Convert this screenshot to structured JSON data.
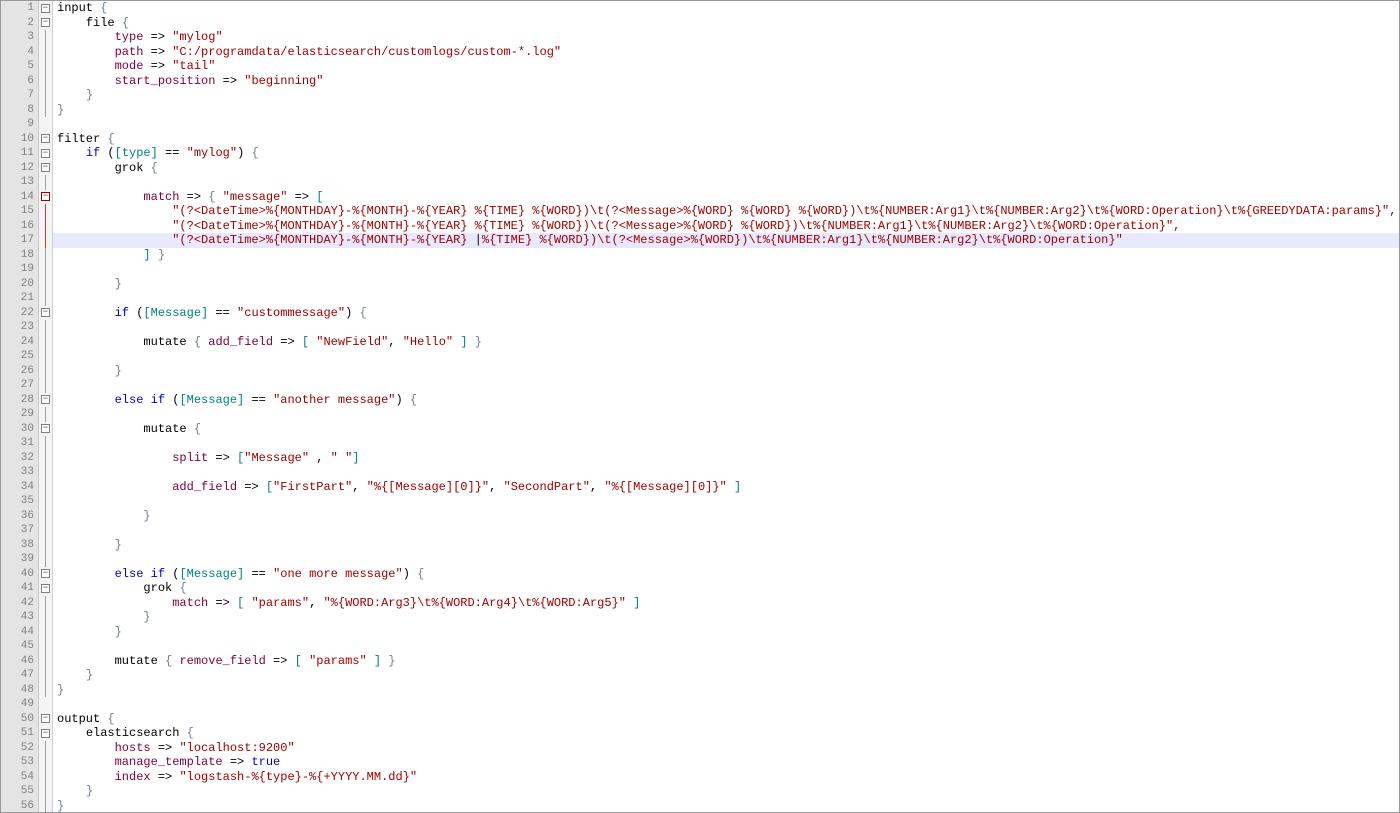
{
  "highlighted_line": 17,
  "lines": [
    {
      "n": 1,
      "fold": "minus",
      "segs": [
        {
          "t": "input",
          "c": "tok-kw"
        },
        {
          "t": " "
        },
        {
          "t": "{",
          "c": "tok-brace"
        }
      ]
    },
    {
      "n": 2,
      "fold": "minus",
      "indent": 4,
      "segs": [
        {
          "t": "file",
          "c": "tok-kw"
        },
        {
          "t": " "
        },
        {
          "t": "{",
          "c": "tok-brace"
        }
      ]
    },
    {
      "n": 3,
      "fold": "v",
      "indent": 8,
      "segs": [
        {
          "t": "type",
          "c": "tok-attr"
        },
        {
          "t": " => "
        },
        {
          "t": "\"mylog\"",
          "c": "tok-s3"
        }
      ]
    },
    {
      "n": 4,
      "fold": "v",
      "indent": 8,
      "segs": [
        {
          "t": "path",
          "c": "tok-attr"
        },
        {
          "t": " => "
        },
        {
          "t": "\"C:/programdata/elasticsearch/customlogs/custom-*.log\"",
          "c": "tok-s3"
        }
      ]
    },
    {
      "n": 5,
      "fold": "v",
      "indent": 8,
      "segs": [
        {
          "t": "mode",
          "c": "tok-attr"
        },
        {
          "t": " => "
        },
        {
          "t": "\"tail\"",
          "c": "tok-s3"
        }
      ]
    },
    {
      "n": 6,
      "fold": "v",
      "indent": 8,
      "segs": [
        {
          "t": "start_position",
          "c": "tok-attr"
        },
        {
          "t": " => "
        },
        {
          "t": "\"beginning\"",
          "c": "tok-s3"
        }
      ]
    },
    {
      "n": 7,
      "fold": "v",
      "indent": 4,
      "segs": [
        {
          "t": "}",
          "c": "tok-brace"
        }
      ]
    },
    {
      "n": 8,
      "fold": "end",
      "segs": [
        {
          "t": "}",
          "c": "tok-brace"
        }
      ]
    },
    {
      "n": 9,
      "fold": "",
      "segs": []
    },
    {
      "n": 10,
      "fold": "minus",
      "segs": [
        {
          "t": "filter",
          "c": "tok-kw"
        },
        {
          "t": " "
        },
        {
          "t": "{",
          "c": "tok-brace"
        }
      ]
    },
    {
      "n": 11,
      "fold": "minus",
      "indent": 4,
      "segs": [
        {
          "t": "if",
          "c": "tok-id"
        },
        {
          "t": " ("
        },
        {
          "t": "[type]",
          "c": "tok-brkt"
        },
        {
          "t": " == "
        },
        {
          "t": "\"mylog\"",
          "c": "tok-s3"
        },
        {
          "t": ") "
        },
        {
          "t": "{",
          "c": "tok-brace"
        }
      ]
    },
    {
      "n": 12,
      "fold": "minus",
      "indent": 8,
      "segs": [
        {
          "t": "grok",
          "c": "tok-kw"
        },
        {
          "t": " "
        },
        {
          "t": "{",
          "c": "tok-brace"
        }
      ]
    },
    {
      "n": 13,
      "fold": "v",
      "segs": []
    },
    {
      "n": 14,
      "fold": "collapse",
      "indent": 12,
      "segs": [
        {
          "t": "match",
          "c": "tok-attr"
        },
        {
          "t": " => "
        },
        {
          "t": "{",
          "c": "tok-brace"
        },
        {
          "t": " "
        },
        {
          "t": "\"message\"",
          "c": "tok-s3"
        },
        {
          "t": " => "
        },
        {
          "t": "[",
          "c": "tok-brkt"
        }
      ]
    },
    {
      "n": 15,
      "fold": "vred",
      "indent": 16,
      "segs": [
        {
          "t": "\"(?<DateTime>%{MONTHDAY}-%{MONTH}-%{YEAR} %{TIME} %{WORD})\\t(?<Message>%{WORD} %{WORD} %{WORD})\\t%{NUMBER:Arg1}\\t%{NUMBER:Arg2}\\t%{WORD:Operation}\\t%{GREEDYDATA:params}\",",
          "c": "tok-s3"
        }
      ]
    },
    {
      "n": 16,
      "fold": "vred",
      "indent": 16,
      "segs": [
        {
          "t": "\"(?<DateTime>%{MONTHDAY}-%{MONTH}-%{YEAR} %{TIME} %{WORD})\\t(?<Message>%{WORD} %{WORD})\\t%{NUMBER:Arg1}\\t%{NUMBER:Arg2}\\t%{WORD:Operation}\",",
          "c": "tok-s3"
        }
      ]
    },
    {
      "n": 17,
      "fold": "vred",
      "indent": 16,
      "segs": [
        {
          "t": "\"(?<DateTime>%{MONTHDAY}-%{MONTH}-%{YEAR} ",
          "c": "tok-s3"
        },
        {
          "t": "|",
          "c": "tok-kw"
        },
        {
          "t": "%{TIME} %{WORD})\\t(?<Message>%{WORD})\\t%{NUMBER:Arg1}\\t%{NUMBER:Arg2}\\t%{WORD:Operation}\"",
          "c": "tok-s3"
        }
      ]
    },
    {
      "n": 18,
      "fold": "endv",
      "indent": 12,
      "segs": [
        {
          "t": "]",
          "c": "tok-brkt"
        },
        {
          "t": " "
        },
        {
          "t": "}",
          "c": "tok-brace"
        }
      ]
    },
    {
      "n": 19,
      "fold": "v",
      "segs": []
    },
    {
      "n": 20,
      "fold": "v",
      "indent": 8,
      "segs": [
        {
          "t": "}",
          "c": "tok-brace"
        }
      ]
    },
    {
      "n": 21,
      "fold": "v",
      "segs": []
    },
    {
      "n": 22,
      "fold": "minus",
      "indent": 8,
      "segs": [
        {
          "t": "if",
          "c": "tok-id"
        },
        {
          "t": " ("
        },
        {
          "t": "[Message]",
          "c": "tok-brkt"
        },
        {
          "t": " == "
        },
        {
          "t": "\"custommessage\"",
          "c": "tok-s3"
        },
        {
          "t": ") "
        },
        {
          "t": "{",
          "c": "tok-brace"
        }
      ]
    },
    {
      "n": 23,
      "fold": "v",
      "segs": []
    },
    {
      "n": 24,
      "fold": "v",
      "indent": 12,
      "segs": [
        {
          "t": "mutate",
          "c": "tok-kw"
        },
        {
          "t": " "
        },
        {
          "t": "{",
          "c": "tok-brace"
        },
        {
          "t": " "
        },
        {
          "t": "add_field",
          "c": "tok-attr"
        },
        {
          "t": " => "
        },
        {
          "t": "[",
          "c": "tok-brkt"
        },
        {
          "t": " "
        },
        {
          "t": "\"NewField\"",
          "c": "tok-s3"
        },
        {
          "t": ", "
        },
        {
          "t": "\"Hello\"",
          "c": "tok-s3"
        },
        {
          "t": " "
        },
        {
          "t": "]",
          "c": "tok-brkt"
        },
        {
          "t": " "
        },
        {
          "t": "}",
          "c": "tok-brace"
        }
      ]
    },
    {
      "n": 25,
      "fold": "v",
      "segs": []
    },
    {
      "n": 26,
      "fold": "v",
      "indent": 8,
      "segs": [
        {
          "t": "}",
          "c": "tok-brace"
        }
      ]
    },
    {
      "n": 27,
      "fold": "v",
      "segs": []
    },
    {
      "n": 28,
      "fold": "minus",
      "indent": 8,
      "segs": [
        {
          "t": "else",
          "c": "tok-id"
        },
        {
          "t": " "
        },
        {
          "t": "if",
          "c": "tok-id"
        },
        {
          "t": " ("
        },
        {
          "t": "[Message]",
          "c": "tok-brkt"
        },
        {
          "t": " == "
        },
        {
          "t": "\"another message\"",
          "c": "tok-s3"
        },
        {
          "t": ") "
        },
        {
          "t": "{",
          "c": "tok-brace"
        }
      ]
    },
    {
      "n": 29,
      "fold": "v",
      "segs": []
    },
    {
      "n": 30,
      "fold": "minus",
      "indent": 12,
      "segs": [
        {
          "t": "mutate",
          "c": "tok-kw"
        },
        {
          "t": " "
        },
        {
          "t": "{",
          "c": "tok-brace"
        }
      ]
    },
    {
      "n": 31,
      "fold": "v",
      "segs": []
    },
    {
      "n": 32,
      "fold": "v",
      "indent": 16,
      "segs": [
        {
          "t": "split",
          "c": "tok-attr"
        },
        {
          "t": " => "
        },
        {
          "t": "[",
          "c": "tok-brkt"
        },
        {
          "t": "\"Message\"",
          "c": "tok-s3"
        },
        {
          "t": " , "
        },
        {
          "t": "\" \"",
          "c": "tok-s3"
        },
        {
          "t": "]",
          "c": "tok-brkt"
        }
      ]
    },
    {
      "n": 33,
      "fold": "v",
      "segs": []
    },
    {
      "n": 34,
      "fold": "v",
      "indent": 16,
      "segs": [
        {
          "t": "add_field",
          "c": "tok-attr"
        },
        {
          "t": " => "
        },
        {
          "t": "[",
          "c": "tok-brkt"
        },
        {
          "t": "\"FirstPart\"",
          "c": "tok-s3"
        },
        {
          "t": ", "
        },
        {
          "t": "\"%{[Message][0]}\"",
          "c": "tok-s3"
        },
        {
          "t": ", "
        },
        {
          "t": "\"SecondPart\"",
          "c": "tok-s3"
        },
        {
          "t": ", "
        },
        {
          "t": "\"%{[Message][0]}\"",
          "c": "tok-s3"
        },
        {
          "t": " "
        },
        {
          "t": "]",
          "c": "tok-brkt"
        }
      ]
    },
    {
      "n": 35,
      "fold": "v",
      "segs": []
    },
    {
      "n": 36,
      "fold": "v",
      "indent": 12,
      "segs": [
        {
          "t": "}",
          "c": "tok-brace"
        }
      ]
    },
    {
      "n": 37,
      "fold": "v",
      "segs": []
    },
    {
      "n": 38,
      "fold": "v",
      "indent": 8,
      "segs": [
        {
          "t": "}",
          "c": "tok-brace"
        }
      ]
    },
    {
      "n": 39,
      "fold": "v",
      "segs": []
    },
    {
      "n": 40,
      "fold": "minus",
      "indent": 8,
      "segs": [
        {
          "t": "else",
          "c": "tok-id"
        },
        {
          "t": " "
        },
        {
          "t": "if",
          "c": "tok-id"
        },
        {
          "t": " ("
        },
        {
          "t": "[Message]",
          "c": "tok-brkt"
        },
        {
          "t": " == "
        },
        {
          "t": "\"one more message\"",
          "c": "tok-s3"
        },
        {
          "t": ") "
        },
        {
          "t": "{",
          "c": "tok-brace"
        }
      ]
    },
    {
      "n": 41,
      "fold": "minus",
      "indent": 12,
      "segs": [
        {
          "t": "grok",
          "c": "tok-kw"
        },
        {
          "t": " "
        },
        {
          "t": "{",
          "c": "tok-brace"
        }
      ]
    },
    {
      "n": 42,
      "fold": "v",
      "indent": 16,
      "segs": [
        {
          "t": "match",
          "c": "tok-attr"
        },
        {
          "t": " => "
        },
        {
          "t": "[",
          "c": "tok-brkt"
        },
        {
          "t": " "
        },
        {
          "t": "\"params\"",
          "c": "tok-s3"
        },
        {
          "t": ", "
        },
        {
          "t": "\"%{WORD:Arg3}\\t%{WORD:Arg4}\\t%{WORD:Arg5}\"",
          "c": "tok-s3"
        },
        {
          "t": " "
        },
        {
          "t": "]",
          "c": "tok-brkt"
        }
      ]
    },
    {
      "n": 43,
      "fold": "v",
      "indent": 12,
      "segs": [
        {
          "t": "}",
          "c": "tok-brace"
        }
      ]
    },
    {
      "n": 44,
      "fold": "v",
      "indent": 8,
      "segs": [
        {
          "t": "}",
          "c": "tok-brace"
        }
      ]
    },
    {
      "n": 45,
      "fold": "v",
      "segs": []
    },
    {
      "n": 46,
      "fold": "v",
      "indent": 8,
      "segs": [
        {
          "t": "mutate",
          "c": "tok-kw"
        },
        {
          "t": " "
        },
        {
          "t": "{",
          "c": "tok-brace"
        },
        {
          "t": " "
        },
        {
          "t": "remove_field",
          "c": "tok-attr"
        },
        {
          "t": " => "
        },
        {
          "t": "[",
          "c": "tok-brkt"
        },
        {
          "t": " "
        },
        {
          "t": "\"params\"",
          "c": "tok-s3"
        },
        {
          "t": " "
        },
        {
          "t": "]",
          "c": "tok-brkt"
        },
        {
          "t": " "
        },
        {
          "t": "}",
          "c": "tok-brace"
        }
      ]
    },
    {
      "n": 47,
      "fold": "v",
      "indent": 4,
      "segs": [
        {
          "t": "}",
          "c": "tok-brace"
        }
      ]
    },
    {
      "n": 48,
      "fold": "end",
      "segs": [
        {
          "t": "}",
          "c": "tok-brace"
        }
      ]
    },
    {
      "n": 49,
      "fold": "",
      "segs": []
    },
    {
      "n": 50,
      "fold": "minus",
      "segs": [
        {
          "t": "output",
          "c": "tok-kw"
        },
        {
          "t": " "
        },
        {
          "t": "{",
          "c": "tok-brace"
        }
      ]
    },
    {
      "n": 51,
      "fold": "minus",
      "indent": 4,
      "segs": [
        {
          "t": "elasticsearch",
          "c": "tok-kw"
        },
        {
          "t": " "
        },
        {
          "t": "{",
          "c": "tok-brace"
        }
      ]
    },
    {
      "n": 52,
      "fold": "v",
      "indent": 8,
      "segs": [
        {
          "t": "hosts",
          "c": "tok-attr"
        },
        {
          "t": " => "
        },
        {
          "t": "\"localhost:9200\"",
          "c": "tok-s3"
        }
      ]
    },
    {
      "n": 53,
      "fold": "v",
      "indent": 8,
      "segs": [
        {
          "t": "manage_template",
          "c": "tok-attr"
        },
        {
          "t": " => "
        },
        {
          "t": "true",
          "c": "tok-bool"
        }
      ]
    },
    {
      "n": 54,
      "fold": "v",
      "indent": 8,
      "segs": [
        {
          "t": "index",
          "c": "tok-attr"
        },
        {
          "t": " => "
        },
        {
          "t": "\"logstash-%{type}-%{+YYYY.MM.dd}\"",
          "c": "tok-s3"
        }
      ]
    },
    {
      "n": 55,
      "fold": "v",
      "indent": 4,
      "segs": [
        {
          "t": "}",
          "c": "tok-brace"
        }
      ]
    },
    {
      "n": 56,
      "fold": "end",
      "segs": [
        {
          "t": "}",
          "c": "tok-brace"
        }
      ]
    }
  ]
}
